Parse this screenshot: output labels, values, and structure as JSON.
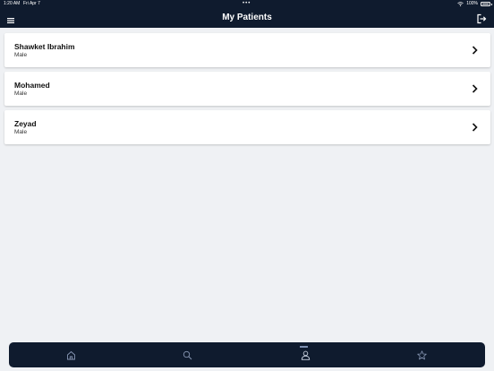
{
  "status_bar": {
    "time": "1:20 AM",
    "date": "Fri Apr 7",
    "dots": "•••",
    "battery": "100%"
  },
  "header": {
    "title": "My Patients"
  },
  "patients": [
    {
      "name": "Shawket Ibrahim",
      "gender": "Male"
    },
    {
      "name": "Mohamed",
      "gender": "Male"
    },
    {
      "name": "Zeyad",
      "gender": "Male"
    }
  ],
  "tab_bar": {
    "tabs": [
      {
        "icon": "home-icon",
        "active": false
      },
      {
        "icon": "search-icon",
        "active": false
      },
      {
        "icon": "profile-icon",
        "active": true
      },
      {
        "icon": "star-icon",
        "active": false
      }
    ]
  },
  "colors": {
    "navy": "#0f1b2e",
    "background": "#eff1f4",
    "card": "#ffffff",
    "icon_inactive": "#8796b3",
    "active_indicator": "#7d8fb0"
  }
}
